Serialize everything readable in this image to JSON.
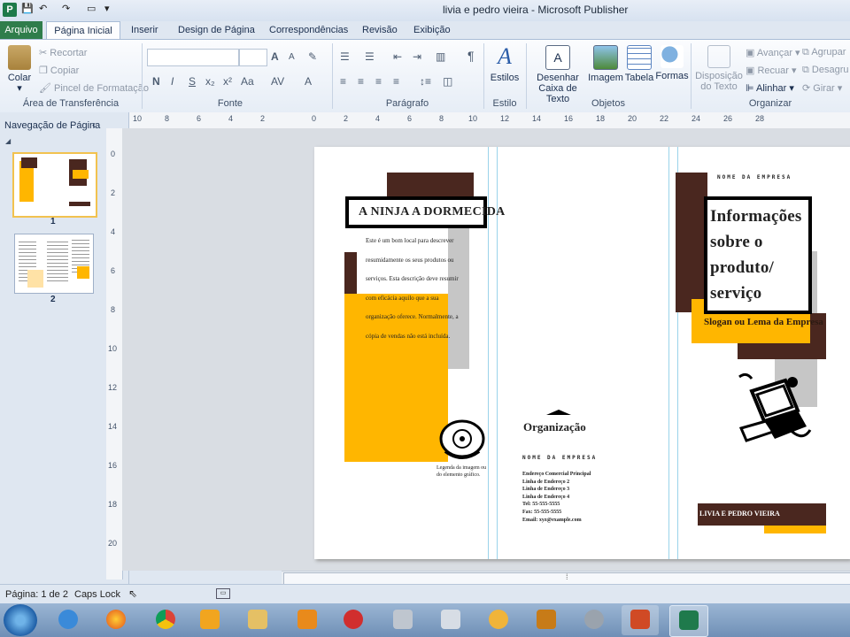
{
  "window": {
    "app_icon": "P",
    "title": "livia e pedro vieira - Microsoft Publisher"
  },
  "tabs": {
    "file": "Arquivo",
    "items": [
      "Página Inicial",
      "Inserir",
      "Design de Página",
      "Correspondências",
      "Revisão",
      "Exibição"
    ]
  },
  "ribbon": {
    "clipboard": {
      "paste": "Colar",
      "cut": "Recortar",
      "copy": "Copiar",
      "format_painter": "Pincel de Formatação",
      "label": "Área de Transferência"
    },
    "font": {
      "label": "Fonte",
      "bold": "N",
      "italic": "I",
      "underline": "S",
      "sub": "x₂",
      "sup": "x²",
      "case": "Aa",
      "grow": "A",
      "shrink": "A"
    },
    "paragraph": {
      "label": "Parágrafo",
      "pilcrow": "¶"
    },
    "styles": {
      "button": "Estilos",
      "label": "Estilo"
    },
    "objects": {
      "draw_textbox_1": "Desenhar",
      "draw_textbox_2": "Caixa de Texto",
      "picture": "Imagem",
      "table": "Tabela",
      "shapes": "Formas",
      "label": "Objetos"
    },
    "arrange": {
      "wrap_1": "Disposição",
      "wrap_2": "do Texto",
      "forward": "Avançar",
      "backward": "Recuar",
      "align": "Alinhar",
      "group": "Agrupar",
      "ungroup": "Desagru",
      "rotate": "Girar",
      "label": "Organizar"
    }
  },
  "nav": {
    "title": "Navegação de Página",
    "pages": [
      "1",
      "2"
    ]
  },
  "ruler": {
    "h": [
      "10",
      "8",
      "6",
      "4",
      "2",
      "0",
      "2",
      "4",
      "6",
      "8",
      "10",
      "12",
      "14",
      "16",
      "18",
      "20",
      "22",
      "24",
      "26",
      "28"
    ],
    "v": [
      "0",
      "2",
      "4",
      "6",
      "8",
      "10",
      "12",
      "14",
      "16",
      "18",
      "20"
    ]
  },
  "doc": {
    "left_heading": "A NINJA A DORMECIDA",
    "left_body": "Este é um bom local para descrever resumidamente os seus produtos ou serviços. Esta descrição deve resumir com eficácia aquilo que a sua organização oferece. Normalmente, a cópia de vendas não está incluída.",
    "caption": "Legenda da imagem ou do elemento gráfico.",
    "org_heading": "Organização",
    "company_name_mid": "NOME DA EMPRESA",
    "address_lines": [
      "Endereço Comercial Principal",
      "Linha de Endereço 2",
      "Linha de Endereço 3",
      "Linha de Endereço 4"
    ],
    "tel": "Tel: 55-555-5555",
    "fax": "Fax: 55-555-5555",
    "email": "Email: xyz@example.com",
    "company_name_right": "NOME DA EMPRESA",
    "info_title": "Informações sobre o produto/ serviço",
    "slogan": "Slogan ou Lema da Empresa",
    "footer_name": "LIVIA E PEDRO VIEIRA"
  },
  "status": {
    "page": "Página: 1 de 2",
    "caps": "Caps Lock"
  },
  "colors": {
    "brown": "#4a271f",
    "yellow": "#ffb600",
    "gray": "#c6c6c6",
    "file_tab": "#2f7d4b"
  },
  "taskbar": {
    "icons": [
      "start-orb-icon",
      "internet-explorer-icon",
      "firefox-icon",
      "chrome-icon",
      "outlook-icon",
      "file-explorer-icon",
      "media-player-icon",
      "opera-icon",
      "camera-icon",
      "calculator-icon",
      "paint-icon",
      "colors-icon",
      "sync-icon",
      "powerpoint-icon",
      "publisher-icon"
    ]
  }
}
